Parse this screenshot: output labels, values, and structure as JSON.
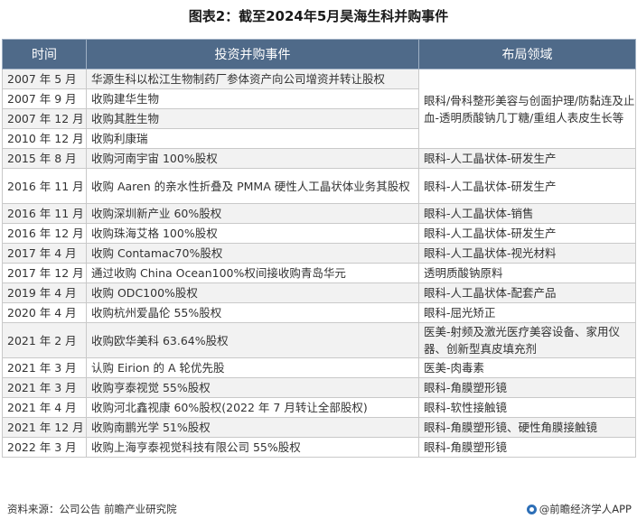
{
  "title": "图表2：截至2024年5月昊海生科并购事件",
  "table": {
    "headers": [
      "时间",
      "投资并购事件",
      "布局领域"
    ],
    "rows": [
      {
        "time": "2007 年 5 月",
        "event": "华源生科以松江生物制药厂参体资产向公司增资并转让股权",
        "domain": "眼科/骨科整形美容与创面护理/防黏连及止血-透明质酸钠几丁糖/重组人表皮生长等"
      },
      {
        "time": "2007 年 9 月",
        "event": "收购建华生物",
        "domain": ""
      },
      {
        "time": "2007 年 12 月",
        "event": "收购其胜生物",
        "domain": ""
      },
      {
        "time": "2010 年 12 月",
        "event": "收购利康瑞",
        "domain": ""
      },
      {
        "time": "2015 年 8 月",
        "event": "收购河南宇宙  100%股权",
        "domain": "眼科-人工晶状体-研发生产"
      },
      {
        "time": "2016 年 11 月",
        "event": "收购  Aaren  的亲水性折叠及  PMMA  硬性人工晶状体业务其股权",
        "domain": "眼科-人工晶状体-研发生产"
      },
      {
        "time": "2016 年 11 月",
        "event": "收购深圳新产业  60%股权",
        "domain": "眼科-人工晶状体-销售"
      },
      {
        "time": "2016 年 12 月",
        "event": "收购珠海艾格  100%股权",
        "domain": "眼科-人工晶状体-研发生产"
      },
      {
        "time": "2017 年 4 月",
        "event": "收购  Contamac70%股权",
        "domain": "眼科-人工晶状体-视光材料"
      },
      {
        "time": "2017 年 12 月",
        "event": "通过收购  China Ocean100%权间接收购青岛华元",
        "domain": "透明质酸钠原料"
      },
      {
        "time": "2019 年 4 月",
        "event": "收购 ODC100%股权",
        "domain": "眼科-人工晶状体-配套产品"
      },
      {
        "time": "2020 年 4 月",
        "event": "收购杭州爱晶伦 55%股权",
        "domain": "眼科-屈光矫正"
      },
      {
        "time": "2021 年 2 月",
        "event": "收购欧华美科 63.64%股权",
        "domain": "医美-射频及激光医疗美容设备、家用仪器、创新型真皮填充剂"
      },
      {
        "time": "2021 年 3 月",
        "event": "认购  Eirion  的 A 轮优先股",
        "domain": "医美-肉毒素"
      },
      {
        "time": "2021 年 3 月",
        "event": "收购亨泰视觉  55%股权",
        "domain": "眼科-角膜塑形镜"
      },
      {
        "time": "2021 年 4 月",
        "event": "收购河北鑫视康  60%股权(2022 年 7 月转让全部股权)",
        "domain": "眼科-软性接触镜"
      },
      {
        "time": "2021 年 12 月",
        "event": "收购南鹏光学  51%股权",
        "domain": "眼科-角膜塑形镜、硬性角膜接触镜"
      },
      {
        "time": "2022 年 3 月",
        "event": "收购上海亨泰视觉科技有限公司 55%股权",
        "domain": "眼科-角膜塑形镜"
      }
    ]
  },
  "footer": {
    "source": "资料来源：公司公告 前瞻产业研究院",
    "brand": "@前瞻经济学人APP"
  },
  "colors": {
    "header_bg": "#4f6a89",
    "stripe_bg": "#f2f2f2",
    "logo": "#2d6fb7"
  }
}
